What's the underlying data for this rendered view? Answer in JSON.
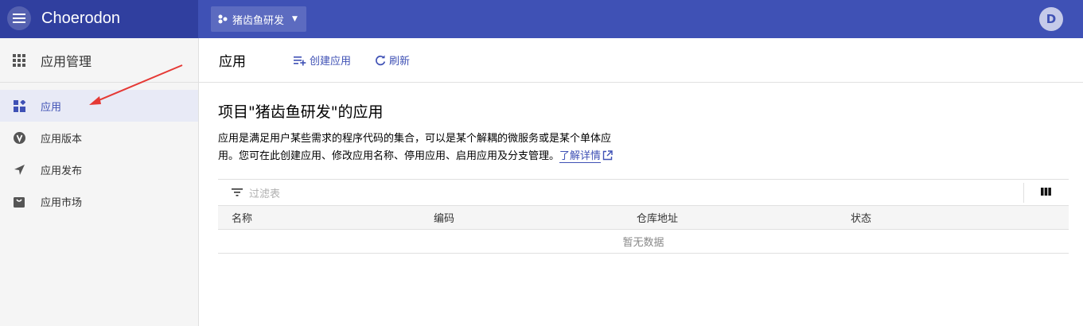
{
  "header": {
    "brand": "Choerodon",
    "project": "猪齿鱼研发",
    "avatar_letter": "D"
  },
  "sidebar": {
    "title": "应用管理",
    "items": [
      {
        "label": "应用",
        "icon": "apps-dashboard-icon",
        "active": true
      },
      {
        "label": "应用版本",
        "icon": "version-v-icon",
        "active": false
      },
      {
        "label": "应用发布",
        "icon": "send-icon",
        "active": false
      },
      {
        "label": "应用市场",
        "icon": "store-icon",
        "active": false
      }
    ]
  },
  "main": {
    "title": "应用",
    "create_label": "创建应用",
    "refresh_label": "刷新",
    "heading": "项目\"猪齿鱼研发\"的应用",
    "description": "应用是满足用户某些需求的程序代码的集合，可以是某个解耦的微服务或是某个单体应用。您可在此创建应用、修改应用名称、停用应用、启用应用及分支管理。",
    "learn_more": "了解详情"
  },
  "table": {
    "filter_placeholder": "过滤表",
    "columns": [
      "名称",
      "编码",
      "仓库地址",
      "状态"
    ],
    "empty_text": "暂无数据"
  },
  "colors": {
    "primary": "#3f51b5",
    "primary_dark": "#303f9f",
    "annotation_arrow": "#e53935"
  }
}
